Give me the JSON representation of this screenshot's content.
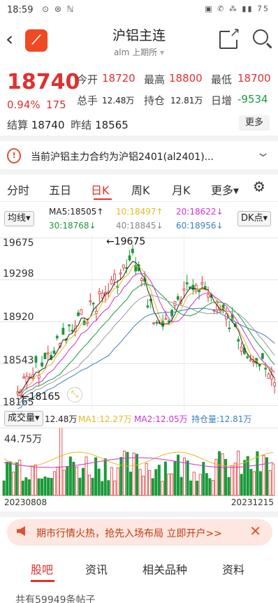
{
  "status": {
    "time": "18:59",
    "icons": "⊙ ⊛ ℕ",
    "right": "▣ ✆ ⁂ ▮▮ 75"
  },
  "header": {
    "title": "沪铝主连",
    "code": "alm",
    "exchange": "上期所"
  },
  "quote": {
    "price": "18740",
    "pct": "0.94%",
    "change": "175",
    "open_label": "今开",
    "open": "18720",
    "high_label": "最高",
    "high": "18800",
    "low_label": "最低",
    "low": "18700",
    "volume_label": "总手",
    "volume": "12.48万",
    "oi_label": "持仓",
    "oi": "12.81万",
    "daily_label": "日增",
    "daily": "-9534",
    "settle_label": "结算",
    "settle": "18740",
    "prev_label": "昨结",
    "prev": "18565",
    "more": "更多"
  },
  "notice": {
    "icon": "!",
    "text": "当前沪铝主力合约为沪铝2401(al2401)..."
  },
  "tabs": [
    "分时",
    "五日",
    "日K",
    "周K",
    "月K",
    "更多▾"
  ],
  "ma": {
    "type_btn": "均线▾",
    "ma5": "MA5:18505↑",
    "ma10": "10:18497↑",
    "ma20": "20:18622↓",
    "ma30": "30:18768↓",
    "ma40": "40:18845↓",
    "ma60": "60:18956↓",
    "dk_btn": "DK点▾"
  },
  "chart": {
    "y_labels": [
      "19675",
      "19298",
      "18920",
      "18543",
      "18165"
    ],
    "high_mark": "←19675",
    "low_mark": "←18165",
    "colors": {
      "ma5": "#222222",
      "ma10": "#e8b820",
      "ma20": "#d030d0",
      "ma30": "#1a9a3a",
      "ma40": "#999999",
      "ma60": "#3a7fc0"
    }
  },
  "volume": {
    "type_btn": "成交量▾",
    "val": "12.48万",
    "ma1": "MA1:12.27万",
    "ma2": "MA2:12.05万",
    "oi": "持仓量:12.81万",
    "max_label": "44.75万"
  },
  "dates": {
    "start": "20230808",
    "end": "20231215"
  },
  "ad": {
    "text": "期市行情火热，抢先入场布局 立即开户>>",
    "close": "✕"
  },
  "bottom_tabs": [
    "股吧",
    "资讯",
    "相关品种",
    "资料"
  ],
  "footer": {
    "text": "共有59949条帖子"
  }
}
